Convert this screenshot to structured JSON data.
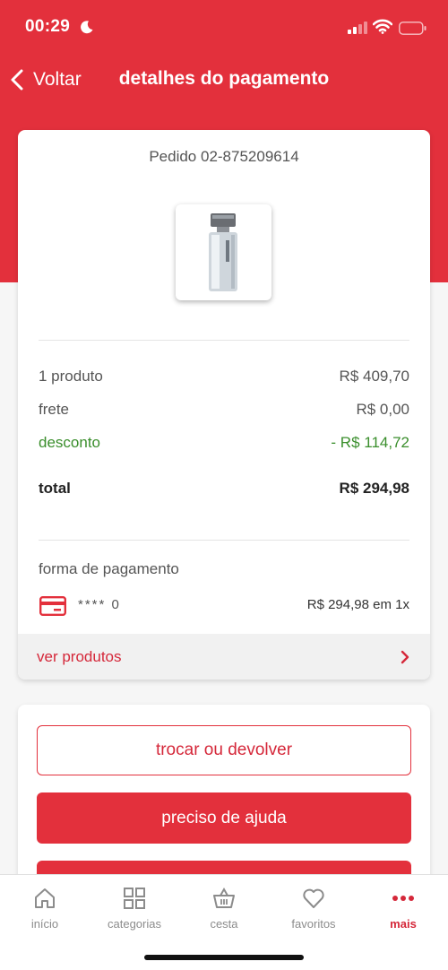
{
  "status_bar": {
    "time": "00:29"
  },
  "nav": {
    "back_label": "Voltar",
    "title": "detalhes do pagamento"
  },
  "order": {
    "id_label": "Pedido 02-875209614",
    "summary": {
      "products_label": "1 produto",
      "products_value": "R$ 409,70",
      "shipping_label": "frete",
      "shipping_value": "R$ 0,00",
      "discount_label": "desconto",
      "discount_value": "- R$ 114,72",
      "total_label": "total",
      "total_value": "R$ 294,98"
    },
    "payment": {
      "label": "forma de pagamento",
      "card_mask": "**** 0",
      "amount": "R$ 294,98 em 1x"
    },
    "view_products_label": "ver produtos"
  },
  "actions": {
    "exchange_label": "trocar ou devolver",
    "help_label": "preciso de ajuda"
  },
  "tabs": [
    {
      "label": "início",
      "icon": "home-icon"
    },
    {
      "label": "categorias",
      "icon": "grid-icon"
    },
    {
      "label": "cesta",
      "icon": "basket-icon"
    },
    {
      "label": "favoritos",
      "icon": "heart-icon"
    },
    {
      "label": "mais",
      "icon": "more-icon",
      "active": true
    }
  ],
  "colors": {
    "brand": "#e3303c",
    "discount": "#3a8e2c"
  }
}
